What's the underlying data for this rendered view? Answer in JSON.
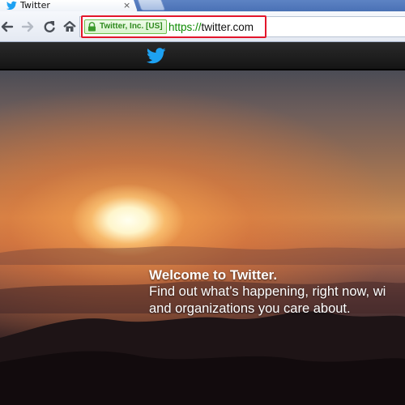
{
  "browser": {
    "tab": {
      "title": "Twitter",
      "close_glyph": "×",
      "favicon": "twitter-bird-icon"
    },
    "toolbar": {
      "back": "back-arrow-icon",
      "forward": "forward-arrow-icon",
      "reload": "reload-icon",
      "home": "home-icon"
    },
    "address_bar": {
      "ev_certificate": "Twitter, Inc. [US]",
      "url_scheme": "https://",
      "url_host": "twitter.com",
      "highlight_color": "#e3162b"
    }
  },
  "page": {
    "header_logo": "twitter-bird-icon",
    "welcome": {
      "title": "Welcome to Twitter.",
      "line1": "Find out what’s happening, right now, wi",
      "line2": "and organizations you care about."
    }
  },
  "colors": {
    "brand": "#1da1f2",
    "ev_green": "#2f8a1f"
  }
}
